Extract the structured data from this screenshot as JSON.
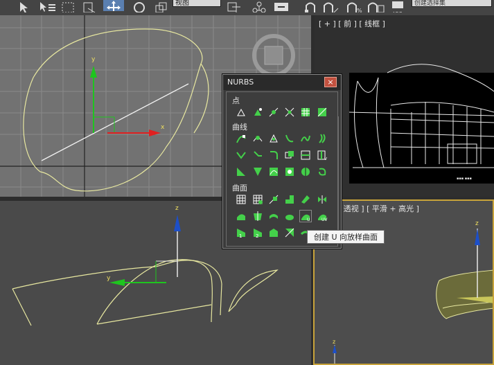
{
  "toolbar": {
    "view_dropdown": "视图",
    "selection_set_placeholder": "创建选择集",
    "icons": [
      "select-icon",
      "select-by-name-icon",
      "region-select-icon",
      "window-crossing-icon",
      "move-icon",
      "rotate-icon",
      "scale-icon",
      "view-ref-icon",
      "pivot-icon",
      "manipulate-icon",
      "keyboard-shortcut-icon",
      "snap-icon",
      "angle-snap-icon",
      "percent-snap-icon",
      "spinner-snap-icon",
      "edit-named-selection-icon",
      "mirror-icon"
    ]
  },
  "viewports": {
    "top": {
      "label": ""
    },
    "front": {
      "label": "[ + ] [ 前 ] [ 线框 ]"
    },
    "left": {
      "label": ""
    },
    "perspective": {
      "label": "[ 透视 ] [ 平滑 + 高光 ]"
    }
  },
  "axes": {
    "x": "x",
    "y": "y",
    "z": "z"
  },
  "nurbs_panel": {
    "title": "NURBS",
    "close": "×",
    "categories": {
      "points": "点",
      "curves": "曲线",
      "surfaces": "曲面"
    }
  },
  "tooltip": "创建 U 向放样曲面",
  "colors": {
    "accent_green": "#44d04a",
    "active_border": "#c9a43a",
    "close_red": "#c2513f"
  }
}
